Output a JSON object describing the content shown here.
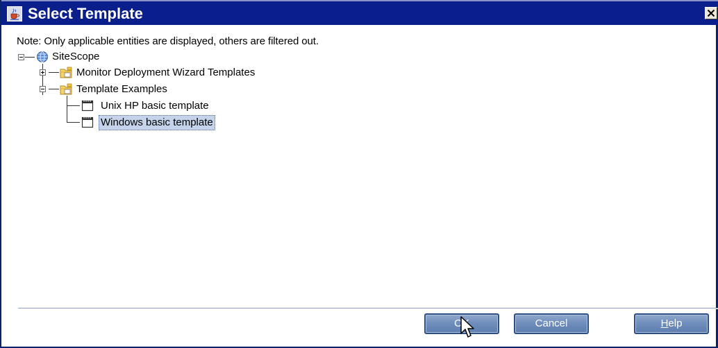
{
  "window": {
    "title": "Select Template",
    "icon": "java-cup-icon",
    "close_icon": "close-icon"
  },
  "note": "Note: Only applicable entities are displayed, others are filtered out.",
  "tree": {
    "root": {
      "label": "SiteScope",
      "icon": "globe-icon",
      "expanded": true
    },
    "folders": [
      {
        "label": "Monitor Deployment Wizard Templates",
        "icon": "folder-icon",
        "expanded": false
      },
      {
        "label": "Template Examples",
        "icon": "folder-icon",
        "expanded": true
      }
    ],
    "templates": [
      {
        "label": "Unix HP basic template",
        "icon": "template-icon",
        "selected": false
      },
      {
        "label": "Windows basic template",
        "icon": "template-icon",
        "selected": true
      }
    ]
  },
  "buttons": {
    "ok": "OK",
    "cancel": "Cancel",
    "help_mnemonic": "H",
    "help_rest": "elp"
  },
  "colors": {
    "titlebar": "#0a1e8c",
    "button": "#6e8cbb",
    "selection": "#c4d3ea"
  }
}
